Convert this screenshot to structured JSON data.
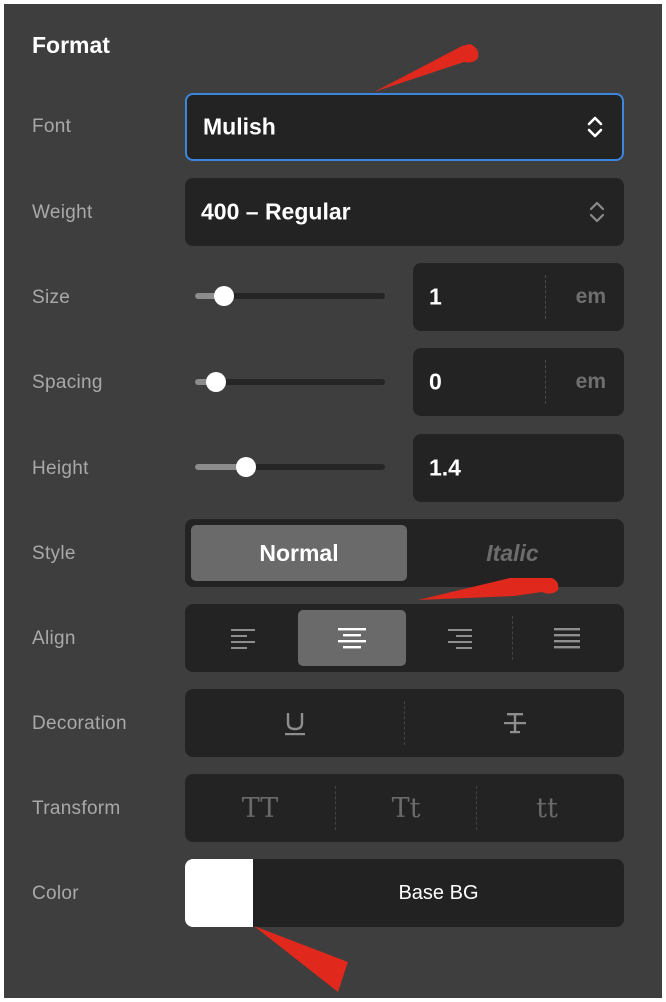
{
  "panel": {
    "title": "Format"
  },
  "font": {
    "label": "Font",
    "value": "Mulish"
  },
  "weight": {
    "label": "Weight",
    "value": "400 – Regular"
  },
  "size": {
    "label": "Size",
    "value": "1",
    "unit": "em",
    "slider_fraction": 0.15
  },
  "spacing": {
    "label": "Spacing",
    "value": "0",
    "unit": "em",
    "slider_fraction": 0.11
  },
  "height": {
    "label": "Height",
    "value": "1.4",
    "slider_fraction": 0.27
  },
  "style": {
    "label": "Style",
    "options": [
      "Normal",
      "Italic"
    ],
    "selected": "Normal"
  },
  "align": {
    "label": "Align",
    "options": [
      "left",
      "center",
      "right",
      "justify"
    ],
    "selected": "center"
  },
  "decoration": {
    "label": "Decoration",
    "options": [
      "underline",
      "strikethrough"
    ]
  },
  "transform": {
    "label": "Transform",
    "options": [
      "TT",
      "Tt",
      "tt"
    ]
  },
  "color": {
    "label": "Color",
    "value": "Base BG",
    "swatch": "#ffffff"
  },
  "colors": {
    "accent_focus": "#3d86e0",
    "annotation_arrow": "#e0281c"
  }
}
